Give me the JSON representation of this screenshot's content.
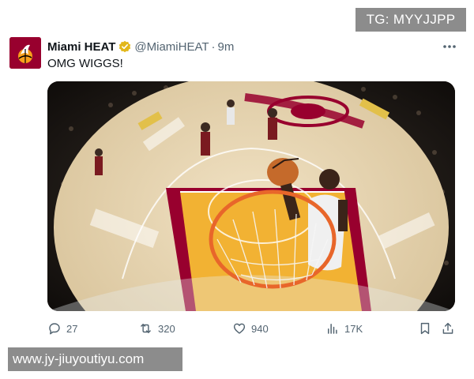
{
  "watermark_top": "TG: MYYJJPP",
  "watermark_bottom": "www.jy-jiuyoutiyu.com",
  "tweet": {
    "author_name": "Miami HEAT",
    "handle": "@MiamiHEAT",
    "separator": "·",
    "time": "9m",
    "text": "OMG WIGGS!",
    "avatar_icon": "miami-heat-logo",
    "verified_color": "#e2b719"
  },
  "actions": {
    "replies": "27",
    "retweets": "320",
    "likes": "940",
    "views": "17K"
  },
  "colors": {
    "text_primary": "#0f1419",
    "text_secondary": "#536471",
    "heat_red": "#98002e",
    "watermark_bg": "#8c8c8c"
  }
}
